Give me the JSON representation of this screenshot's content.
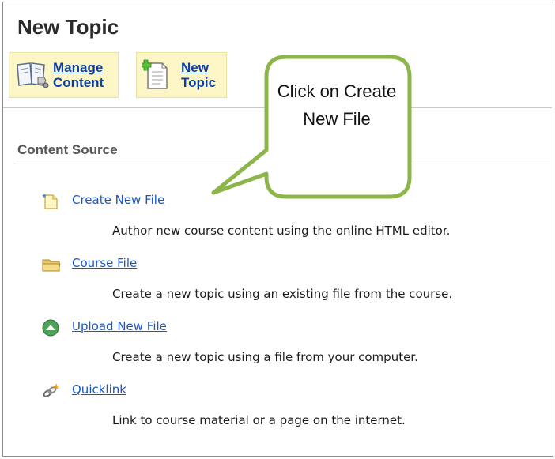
{
  "header": {
    "title": "New Topic"
  },
  "toolbar": {
    "manage_content": "Manage\nContent",
    "new_topic": "New\nTopic"
  },
  "section": {
    "title": "Content Source"
  },
  "sources": [
    {
      "label": "Create New File",
      "desc": "Author new course content using the online HTML editor.",
      "icon": "new-file-icon"
    },
    {
      "label": "Course File",
      "desc": "Create a new topic using an existing file from the course.",
      "icon": "folder-icon"
    },
    {
      "label": "Upload New File",
      "desc": "Create a new topic using a file from your computer.",
      "icon": "upload-icon"
    },
    {
      "label": "Quicklink",
      "desc": "Link to course material or a page on the internet.",
      "icon": "quicklink-icon"
    }
  ],
  "callout": {
    "text": "Click on Create New File"
  },
  "colors": {
    "link": "#1a54c9",
    "toolbar_bg": "#fdf7c8",
    "callout_border": "#8db64a",
    "upload_icon": "#4fa15a"
  }
}
